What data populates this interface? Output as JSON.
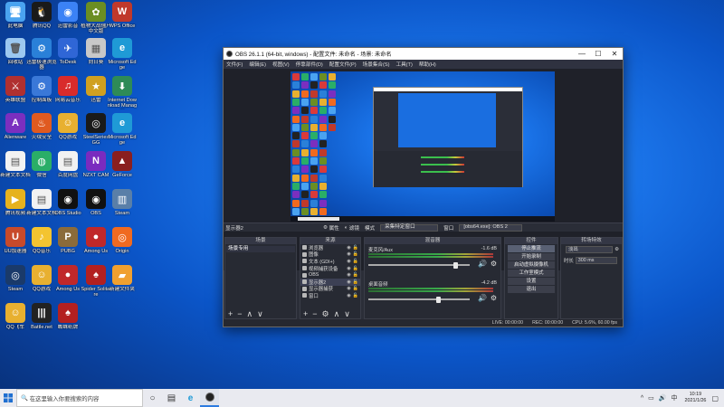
{
  "desktop_icons": [
    {
      "label": "此电脑",
      "color": "#4aa3f0",
      "glyph": "🖥"
    },
    {
      "label": "腾讯QQ",
      "color": "#1a1a1a",
      "glyph": "🐧"
    },
    {
      "label": "迅雷影音",
      "color": "#3b82f6",
      "glyph": "◉"
    },
    {
      "label": "植物大战僵尸中文版",
      "color": "#6b8e23",
      "glyph": "✿"
    },
    {
      "label": "WPS Office",
      "color": "#c0392b",
      "glyph": "W"
    },
    {
      "label": "回收站",
      "color": "#9cc8f0",
      "glyph": "🗑"
    },
    {
      "label": "迅雷极速浏览器",
      "color": "#2a80d8",
      "glyph": "⚙"
    },
    {
      "label": "ToDesk",
      "color": "#2f66d6",
      "glyph": "✈"
    },
    {
      "label": "向日葵",
      "color": "#c8c8c8",
      "glyph": "▦"
    },
    {
      "label": "Microsoft Edge",
      "color": "#1f9ad6",
      "glyph": "e"
    },
    {
      "label": "英雄联盟",
      "color": "#b03030",
      "glyph": "⚔"
    },
    {
      "label": "控制面板",
      "color": "#3a78d8",
      "glyph": "⚙"
    },
    {
      "label": "网易云音乐",
      "color": "#d92b2b",
      "glyph": "♫"
    },
    {
      "label": "迅雷",
      "color": "#d0a020",
      "glyph": "★"
    },
    {
      "label": "Internet Download Manager",
      "color": "#2e8b57",
      "glyph": "⬇"
    },
    {
      "label": "Alienware",
      "color": "#7b2fbf",
      "glyph": "A"
    },
    {
      "label": "火绒安全",
      "color": "#e05a20",
      "glyph": "♨"
    },
    {
      "label": "QQ游戏",
      "color": "#e8b030",
      "glyph": "☺"
    },
    {
      "label": "SteelSeries GG",
      "color": "#1a1a1a",
      "glyph": "◎"
    },
    {
      "label": "Microsoft Edge",
      "color": "#1f9ad6",
      "glyph": "e"
    },
    {
      "label": "新建文本文档",
      "color": "#f2f2f2",
      "glyph": "▤"
    },
    {
      "label": "微信",
      "color": "#2aae67",
      "glyph": "◍"
    },
    {
      "label": "百度网盘",
      "color": "#f2f2f2",
      "glyph": "▤"
    },
    {
      "label": "NZXT CAM",
      "color": "#7a2bbf",
      "glyph": "N"
    },
    {
      "label": "GeForce",
      "color": "#8a1f1f",
      "glyph": "▲"
    },
    {
      "label": "腾讯视频",
      "color": "#e6b21e",
      "glyph": "▶"
    },
    {
      "label": "新建文本文档",
      "color": "#f2f2f2",
      "glyph": "▤"
    },
    {
      "label": "OBS Studio",
      "color": "#111111",
      "glyph": "◉"
    },
    {
      "label": "OBS",
      "color": "#111111",
      "glyph": "◉"
    },
    {
      "label": "Steam",
      "color": "#5a7fa8",
      "glyph": "▥"
    },
    {
      "label": "UU加速器",
      "color": "#c84a2a",
      "glyph": "U"
    },
    {
      "label": "QQ音乐",
      "color": "#f4c430",
      "glyph": "♪"
    },
    {
      "label": "PUBG",
      "color": "#8b6b3a",
      "glyph": "P"
    },
    {
      "label": "Among Us",
      "color": "#c0282a",
      "glyph": "●"
    },
    {
      "label": "Origin",
      "color": "#f06a20",
      "glyph": "◎"
    },
    {
      "label": "Steam",
      "color": "#1a3a6a",
      "glyph": "◎"
    },
    {
      "label": "QQ游戏",
      "color": "#e8b030",
      "glyph": "☺"
    },
    {
      "label": "Among Us",
      "color": "#c0282a",
      "glyph": "●"
    },
    {
      "label": "Spider Solitaire",
      "color": "#b32020",
      "glyph": "♠"
    },
    {
      "label": "新建文件夹",
      "color": "#f0a030",
      "glyph": "▰"
    },
    {
      "label": "QQ飞车",
      "color": "#e8b030",
      "glyph": "☺"
    },
    {
      "label": "Battle.net",
      "color": "#222222",
      "glyph": "|||"
    },
    {
      "label": "蜘蛛纸牌",
      "color": "#b32020",
      "glyph": "♠"
    }
  ],
  "obs": {
    "title": "OBS 26.1.1 (64-bit, windows) - 配置文件: 未命名 - 场景: 未命名",
    "window_controls": {
      "minimize": "—",
      "maximize": "☐",
      "close": "✕"
    },
    "menu": [
      "文件(F)",
      "编辑(E)",
      "视图(V)",
      "停靠部件(D)",
      "配置文件(P)",
      "场景集合(S)",
      "工具(T)",
      "帮助(H)"
    ],
    "source_toolbar": {
      "selected_source": "显示器2",
      "properties": "属性",
      "filters": "滤镜",
      "mode_label": "模式",
      "mode_value": "采集特定窗口",
      "window_label": "窗口",
      "window_value": "[obs64.exe]: OBS 2"
    },
    "scenes": {
      "header": "场景",
      "items": [
        "场景专用"
      ],
      "footer": [
        "+",
        "−",
        "∧",
        "∨"
      ]
    },
    "sources": {
      "header": "来源",
      "items": [
        {
          "name": "浏览器",
          "active": false
        },
        {
          "name": "图像",
          "active": false
        },
        {
          "name": "文本 (GDI+)",
          "active": false
        },
        {
          "name": "视频捕获设备",
          "active": false
        },
        {
          "name": "OBS",
          "active": false
        },
        {
          "name": "显示器2",
          "active": true
        },
        {
          "name": "显示器捕获",
          "active": false
        },
        {
          "name": "窗口",
          "active": false
        }
      ],
      "footer": [
        "+",
        "−",
        "⚙",
        "∧",
        "∨"
      ]
    },
    "mixer": {
      "header": "混音器",
      "channels": [
        {
          "name": "麦克风/Aux",
          "db": "-1.6 dB",
          "level": 0.86
        },
        {
          "name": "桌面音频",
          "db": "-4.2 dB",
          "level": 0.69
        }
      ]
    },
    "controls": {
      "header": "控件",
      "buttons": [
        "停止推流",
        "开始录制",
        "启动虚拟摄像机",
        "工作室模式",
        "设置",
        "退出"
      ]
    },
    "transitions": {
      "header": "转场特效",
      "type": "淡出",
      "duration_label": "时长",
      "duration_value": "300 ms"
    },
    "status": {
      "live": "LIVE: 00:00:00",
      "rec": "REC: 00:00:00",
      "cpu": "CPU: 5.6%, 60.00 fps"
    }
  },
  "taskbar": {
    "search_placeholder": "在这里输入你要搜索的内容",
    "time": "10:19",
    "date": "2021/1/26",
    "tray_text": "中",
    "tray_icons": [
      "^",
      "▭",
      "🔊",
      "中"
    ]
  }
}
